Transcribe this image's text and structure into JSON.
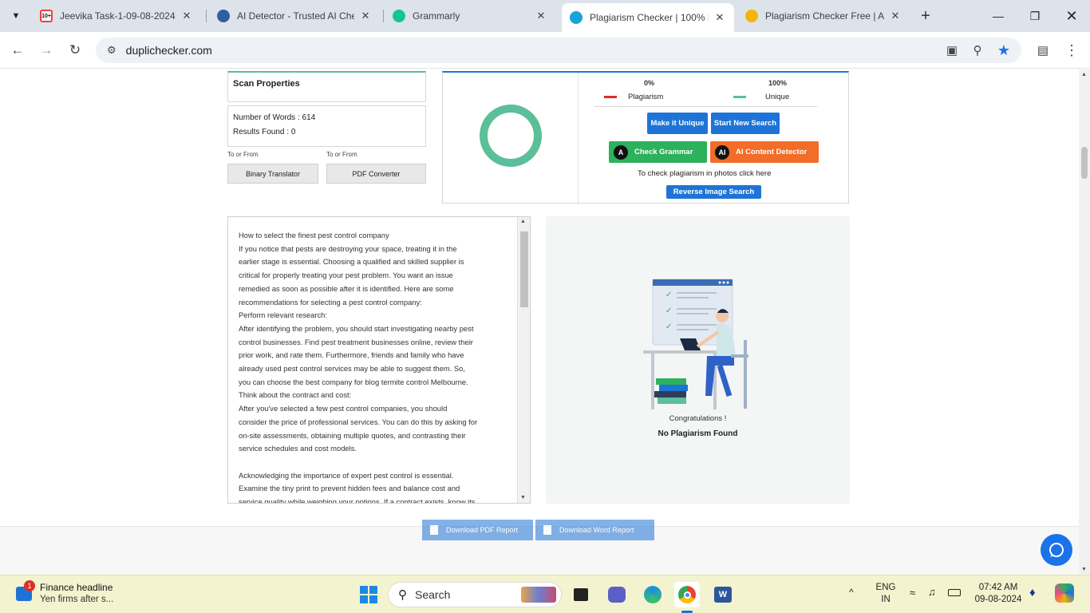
{
  "tabs": [
    {
      "title": "Jeevika Task-1-09-08-2024 -",
      "icon_color": "#ea4335",
      "icon": "gmail-icon",
      "badge": "10+"
    },
    {
      "title": "AI Detector - Trusted AI Che",
      "icon_color": "#2f5f9e",
      "icon": "ai-detector-icon"
    },
    {
      "title": "Grammarly",
      "icon_color": "#15c39a",
      "icon": "grammarly-icon"
    },
    {
      "title": "Plagiarism Checker | 100% F",
      "icon_color": "#1aa3d9",
      "icon": "duplichecker-icon"
    },
    {
      "title": "Plagiarism Checker Free | Ac",
      "icon_color": "#f4b400",
      "icon": "search-plag-icon"
    }
  ],
  "browser": {
    "url": "duplichecker.com"
  },
  "scan": {
    "title": "Scan Properties",
    "words_label": "Number of Words : ",
    "words_value": "614",
    "results_label": "Results Found : ",
    "results_value": "0",
    "to_from_1": "To or From",
    "to_from_2": "To or From",
    "binary_btn": "Binary Translator",
    "pdf_btn": "PDF Converter"
  },
  "stats": {
    "plag_pct": "0%",
    "plag_label": "Plagiarism",
    "unique_pct": "100%",
    "unique_label": "Unique",
    "plag_color": "#d93025",
    "unique_color": "#5bbf9a",
    "unique_fraction": 1.0
  },
  "actions": {
    "make_unique": "Make it Unique",
    "start_new": "Start New Search",
    "check_grammar": "Check Grammar",
    "ai_detector": "AI Content Detector",
    "photo_note": "To check plagiarism in photos click here",
    "reverse_image": "Reverse Image Search"
  },
  "text_lines": [
    "How to select the finest pest control company",
    "If you notice that pests are destroying your space, treating it in the",
    "earlier stage is essential. Choosing a qualified and skilled supplier is",
    "critical for properly treating your pest problem. You want an issue",
    "remedied as soon as possible after it is identified. Here are some",
    "recommendations for selecting a pest control company:",
    "Perform relevant research:",
    "After identifying the problem, you should start investigating nearby pest",
    "control businesses. Find pest treatment businesses online, review their",
    "prior work, and rate them. Furthermore, friends and family who have",
    "already used pest control services may be able to suggest them. So,",
    "you can choose the best company for blog termite control Melbourne.",
    "Think about the contract and cost:",
    "After you've selected a few pest control companies, you should",
    "consider the price of professional services. You can do this by asking for",
    "on-site assessments, obtaining multiple quotes, and contrasting their",
    "service schedules and cost models.",
    "",
    "Acknowledging the importance of expert pest control is essential.",
    "Examine the tiny print to prevent hidden fees and balance cost and",
    "service quality while weighing your options. If a contract exists, know its"
  ],
  "result": {
    "congrats": "Congratulations !",
    "message": "No Plagiarism Found"
  },
  "downloads": {
    "pdf": "Download PDF Report",
    "word": "Download Word Report"
  },
  "taskbar": {
    "news_title": "Finance headline",
    "news_sub": "Yen firms after s...",
    "news_badge": "1",
    "search_placeholder": "Search",
    "lang1": "ENG",
    "lang2": "IN",
    "time": "07:42 AM",
    "date": "09-08-2024"
  }
}
